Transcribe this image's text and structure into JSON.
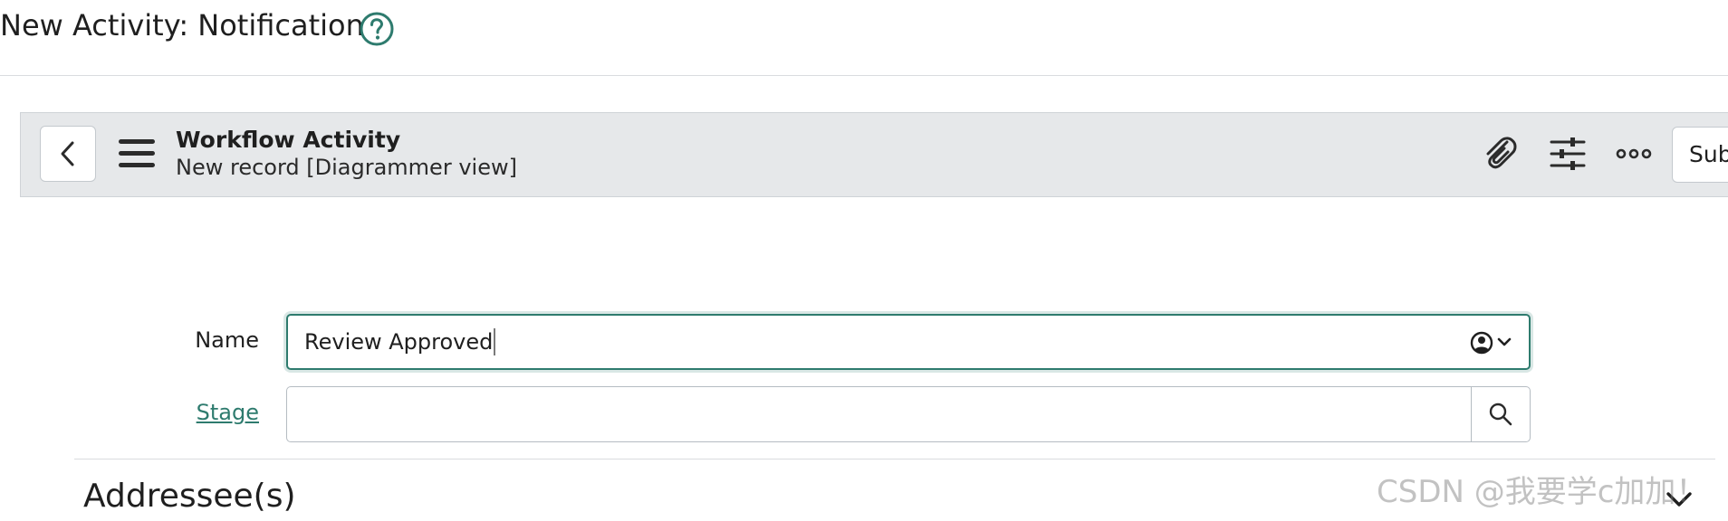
{
  "header": {
    "title": "New Activity: Notification",
    "help_icon": "question-circle-icon"
  },
  "toolbar": {
    "back_icon": "chevron-left-icon",
    "menu_icon": "hamburger-menu-icon",
    "record_title": "Workflow Activity",
    "record_subtitle": "New record [Diagrammer view]",
    "icons": [
      "paperclip-icon",
      "sliders-icon",
      "more-dots-icon"
    ],
    "submit_label": "Sub"
  },
  "form": {
    "name": {
      "label": "Name",
      "value": "Review Approved",
      "picker_icon": "user-circle-dropdown-icon"
    },
    "stage": {
      "label": "Stage",
      "value": "",
      "search_icon": "search-icon"
    }
  },
  "section": {
    "title": "Addressee(s)",
    "toggle_icon": "chevron-down-icon"
  },
  "watermark": "CSDN @我要学c加加！",
  "colors": {
    "accent": "#2e7b6e",
    "toolbar_bg": "#e6e8ea",
    "border": "#b5bcc2"
  }
}
